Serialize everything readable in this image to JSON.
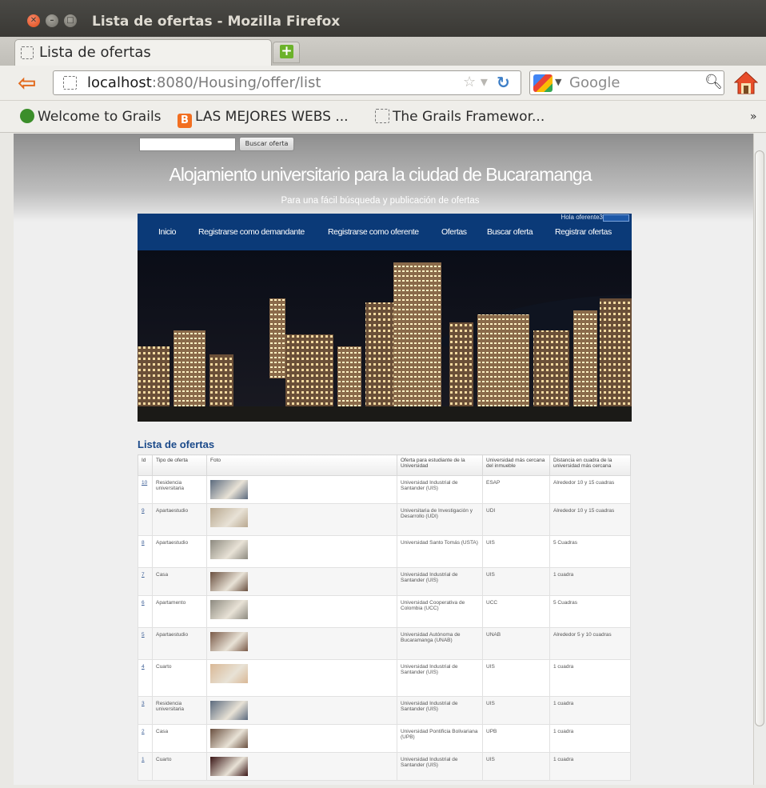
{
  "window": {
    "title": "Lista de ofertas - Mozilla Firefox"
  },
  "tab": {
    "label": "Lista de ofertas"
  },
  "urlbar": {
    "host": "localhost",
    "path": ":8080/Housing/offer/list"
  },
  "searchbar": {
    "placeholder": "Google"
  },
  "bookmarks": [
    {
      "label": "Welcome to Grails"
    },
    {
      "label": "LAS MEJORES WEBS ..."
    },
    {
      "label": "The Grails Framewor..."
    }
  ],
  "page": {
    "search_button": "Buscar oferta",
    "title": "Alojamiento universitario para la ciudad de Bucaramanga",
    "subtitle": "Para una fácil búsqueda y publicación de ofertas",
    "greeting": "Hola oferente3",
    "menu": [
      "Inicio",
      "Registrarse como demandante",
      "Registrarse como oferente",
      "Ofertas",
      "Buscar oferta",
      "Registrar ofertas"
    ],
    "list_title": "Lista de ofertas"
  },
  "table": {
    "headers": [
      "Id",
      "Tipo de oferta",
      "Foto",
      "Oferta para estudiante de la Universidad",
      "Universidad más cercana del inmueble",
      "Distancia en cuadra de la universidad más cercana"
    ],
    "rows": [
      {
        "id": "10",
        "tipo": "Residencia universitaria",
        "oferta": "Universidad Industrial de Santander (UIS)",
        "univ": "ESAP",
        "dist": "Alrededor 10 y 15 cuadras",
        "thumb": "#5b6a7e"
      },
      {
        "id": "9",
        "tipo": "Apartaestudio",
        "oferta": "Universitaria de Investigación y Desarrollo (UDI)",
        "univ": "UDI",
        "dist": "Alrededor 10 y 15 cuadras",
        "thumb": "#b8a890"
      },
      {
        "id": "8",
        "tipo": "Apartaestudio",
        "oferta": "Universidad Santo Tomás (USTA)",
        "univ": "UIS",
        "dist": "5 Cuadras",
        "thumb": "#8d8a80"
      },
      {
        "id": "7",
        "tipo": "Casa",
        "oferta": "Universidad Industrial de Santander (UIS)",
        "univ": "UIS",
        "dist": "1 cuadra",
        "thumb": "#6a5040"
      },
      {
        "id": "6",
        "tipo": "Apartamento",
        "oferta": "Universidad Cooperativa de Colombia (UCC)",
        "univ": "UCC",
        "dist": "5 Cuadras",
        "thumb": "#8d8a80"
      },
      {
        "id": "5",
        "tipo": "Apartaestudio",
        "oferta": "Universidad Autónoma de Bucaramanga (UNAB)",
        "univ": "UNAB",
        "dist": "Alrededor 5 y 10 cuadras",
        "thumb": "#7a5a48"
      },
      {
        "id": "4",
        "tipo": "Cuarto",
        "oferta": "Universidad Industrial de Santander (UIS)",
        "univ": "UIS",
        "dist": "1 cuadra",
        "thumb": "#d9b896"
      },
      {
        "id": "3",
        "tipo": "Residencia universitaria",
        "oferta": "Universidad Industrial de Santander (UIS)",
        "univ": "UIS",
        "dist": "1 cuadra",
        "thumb": "#5b6a7e"
      },
      {
        "id": "2",
        "tipo": "Casa",
        "oferta": "Universidad Pontificia Bolivariana (UPB)",
        "univ": "UPB",
        "dist": "1 cuadra",
        "thumb": "#6a5040"
      },
      {
        "id": "1",
        "tipo": "Cuarto",
        "oferta": "Universidad Industrial de Santander (UIS)",
        "univ": "UIS",
        "dist": "1 cuadra",
        "thumb": "#3a1616"
      }
    ]
  }
}
